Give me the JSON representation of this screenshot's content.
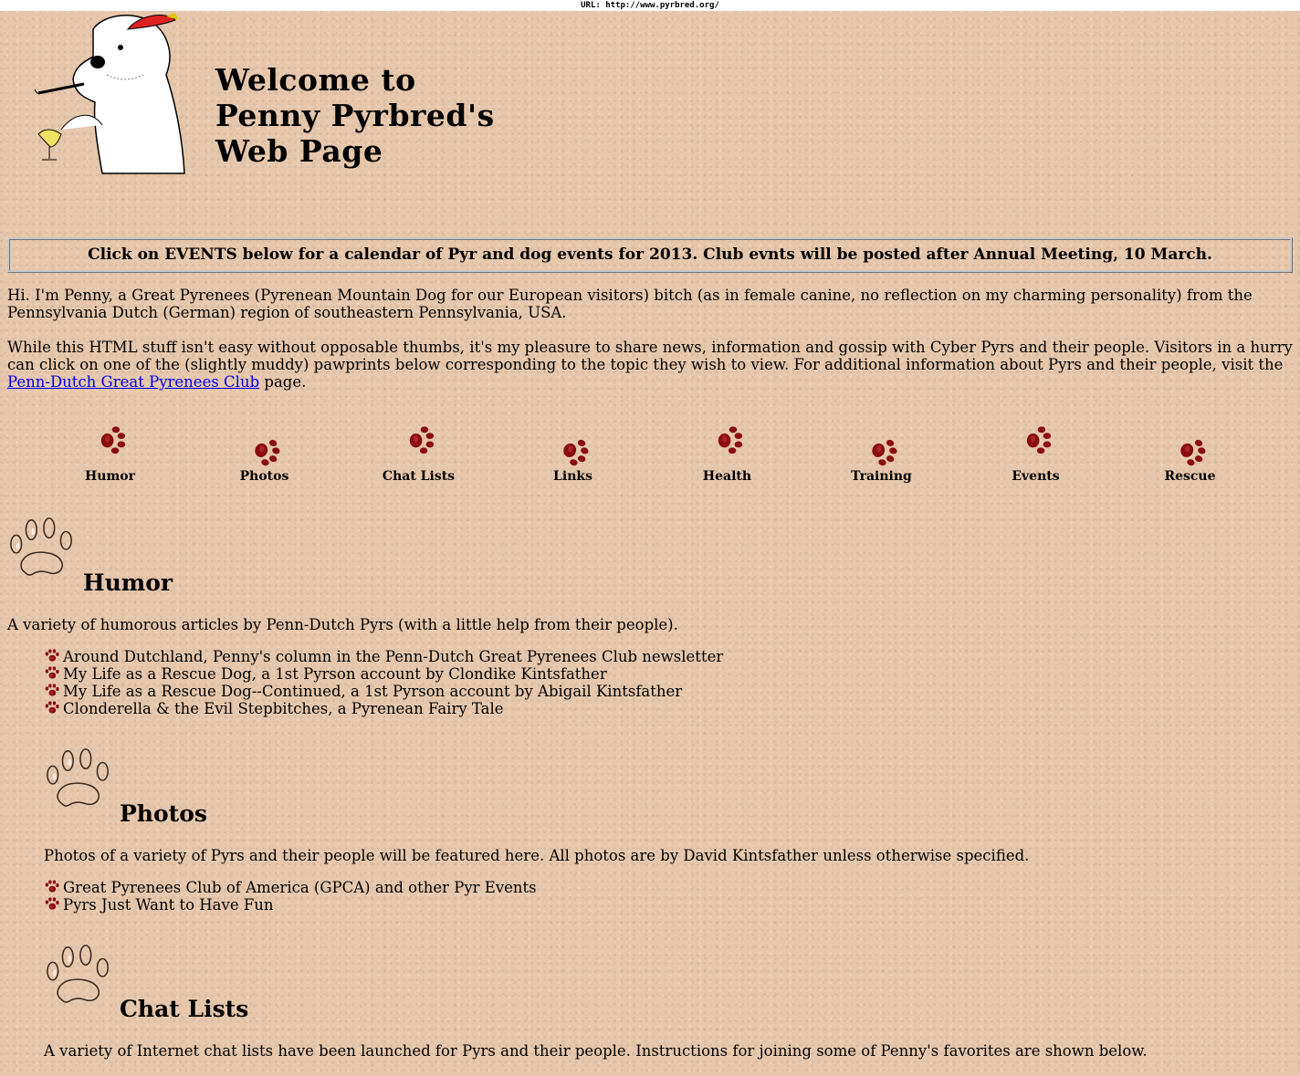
{
  "url_bar": "URL: http://www.pyrbred.org/",
  "title_lines": [
    "Welcome to",
    "Penny Pyrbred's",
    "Web Page"
  ],
  "banner": "Click on EVENTS below for a calendar of Pyr and dog events for 2013. Club evnts will be posted after Annual Meeting, 10 March.",
  "intro1": "Hi. I'm Penny, a Great Pyrenees (Pyrenean Mountain Dog for our European visitors) bitch (as in female canine, no reflection on my charming personality) from the Pennsylvania Dutch (German) region of southeastern Pennsylvania, USA.",
  "intro2": {
    "before": "While this HTML stuff isn't easy without opposable thumbs, it's my pleasure to share news, information and gossip with Cyber Pyrs and their people. Visitors in a hurry can click on one of the (slightly muddy) pawprints below corresponding to the topic they wish to view. For additional information about Pyrs and their people, visit the ",
    "link": "Penn-Dutch Great Pyrenees Club",
    "after": " page."
  },
  "nav": [
    {
      "label": "Humor"
    },
    {
      "label": "Photos"
    },
    {
      "label": "Chat Lists"
    },
    {
      "label": "Links"
    },
    {
      "label": "Health"
    },
    {
      "label": "Training"
    },
    {
      "label": "Events"
    },
    {
      "label": "Rescue"
    }
  ],
  "sections": {
    "humor": {
      "title": "Humor",
      "desc": "A variety of humorous articles by Penn-Dutch Pyrs (with a little help from their people).",
      "items": [
        "Around Dutchland, Penny's column in the Penn-Dutch Great Pyrenees Club newsletter",
        "My Life as a Rescue Dog, a 1st Pyrson account by Clondike Kintsfather",
        "My Life as a Rescue Dog--Continued, a 1st Pyrson account by Abigail Kintsfather",
        "Clonderella & the Evil Stepbitches, a Pyrenean Fairy Tale"
      ]
    },
    "photos": {
      "title": "Photos",
      "desc": "Photos of a variety of Pyrs and their people will be featured here. All photos are by David Kintsfather unless otherwise specified.",
      "items": [
        "Great Pyrenees Club of America (GPCA) and other Pyr Events",
        "Pyrs Just Want to Have Fun"
      ]
    },
    "chat": {
      "title": "Chat Lists",
      "desc": "A variety of Internet chat lists have been launched for Pyrs and their people. Instructions for joining some of Penny's favorites are shown below."
    }
  },
  "colors": {
    "background": "#e6c7ab",
    "paw": "#8b0d0d",
    "link": "#0000ee"
  }
}
